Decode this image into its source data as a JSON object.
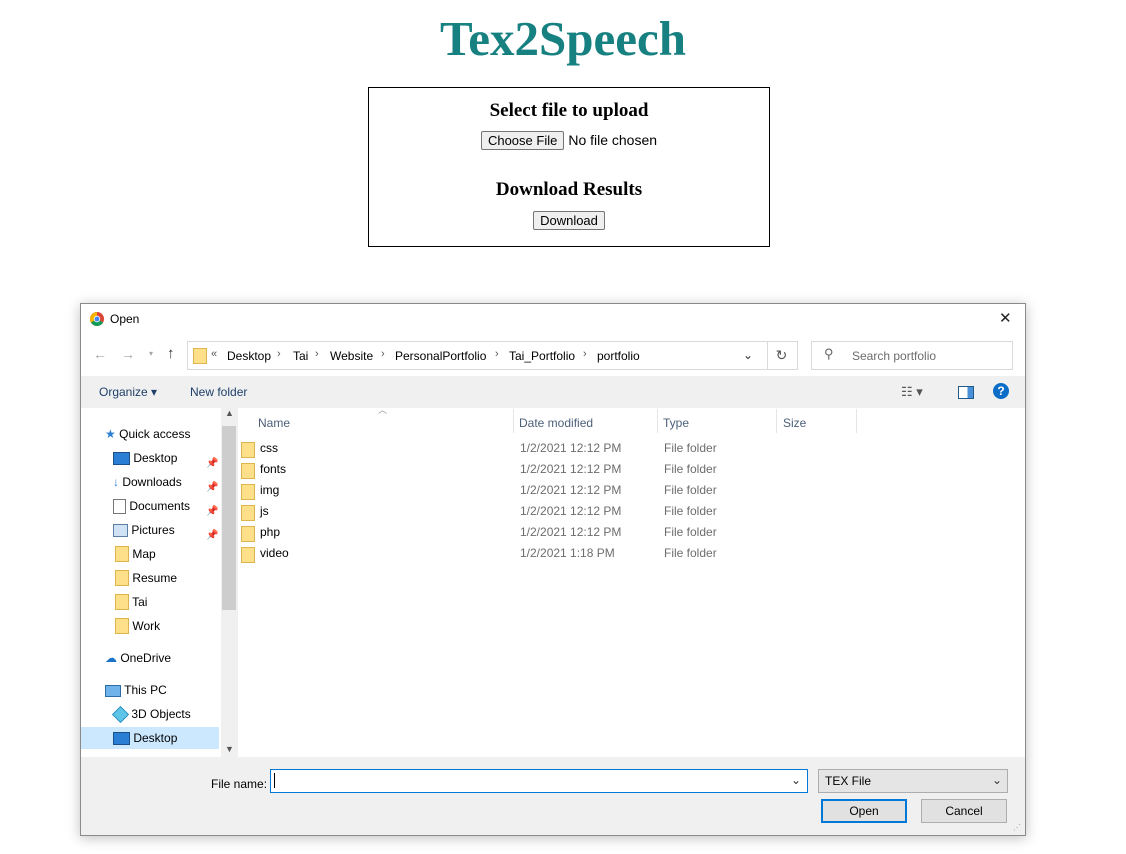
{
  "page": {
    "title": "Tex2Speech",
    "upload_heading": "Select file to upload",
    "choose_file_label": "Choose File",
    "no_file_text": "No file chosen",
    "download_heading": "Download Results",
    "download_label": "Download"
  },
  "dialog": {
    "title": "Open",
    "close_glyph": "✕",
    "breadcrumb_prefix": "«",
    "breadcrumb": [
      "Desktop",
      "Tai",
      "Website",
      "PersonalPortfolio",
      "Tai_Portfolio",
      "portfolio"
    ],
    "search_placeholder": "Search portfolio",
    "organize_label": "Organize ▾",
    "new_folder_label": "New folder",
    "nav": {
      "quick_access": "Quick access",
      "items": [
        "Desktop",
        "Downloads",
        "Documents",
        "Pictures",
        "Map",
        "Resume",
        "Tai",
        "Work"
      ],
      "onedrive": "OneDrive",
      "this_pc": "This PC",
      "objects3d": "3D Objects",
      "desktop_pc": "Desktop"
    },
    "columns": [
      "Name",
      "Date modified",
      "Type",
      "Size"
    ],
    "files": [
      {
        "name": "css",
        "date": "1/2/2021 12:12 PM",
        "type": "File folder"
      },
      {
        "name": "fonts",
        "date": "1/2/2021 12:12 PM",
        "type": "File folder"
      },
      {
        "name": "img",
        "date": "1/2/2021 12:12 PM",
        "type": "File folder"
      },
      {
        "name": "js",
        "date": "1/2/2021 12:12 PM",
        "type": "File folder"
      },
      {
        "name": "php",
        "date": "1/2/2021 12:12 PM",
        "type": "File folder"
      },
      {
        "name": "video",
        "date": "1/2/2021 1:18 PM",
        "type": "File folder"
      }
    ],
    "file_name_label": "File name:",
    "file_name_value": "",
    "file_type": "TEX File",
    "open_label": "Open",
    "cancel_label": "Cancel"
  },
  "colors": {
    "title": "#178080",
    "selection": "#cce8ff",
    "accent": "#0078d7"
  },
  "icons": [
    "chrome-icon",
    "close-icon",
    "back-arrow-icon",
    "forward-arrow-icon",
    "up-arrow-icon",
    "refresh-icon",
    "search-icon",
    "view-options-icon",
    "preview-pane-icon",
    "help-icon",
    "folder-icon",
    "star-icon",
    "pin-icon",
    "cloud-icon",
    "computer-icon"
  ]
}
